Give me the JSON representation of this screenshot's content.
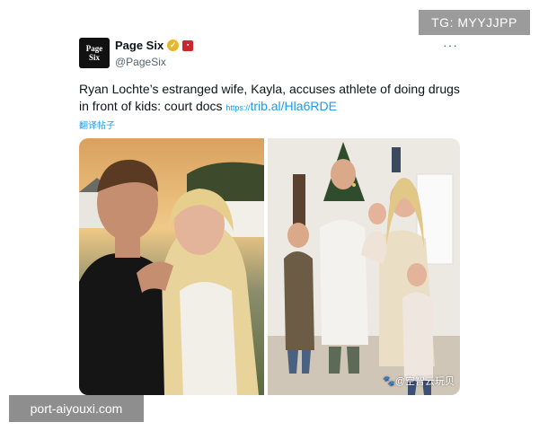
{
  "overlay": {
    "top_right_tag": "TG: MYYJJPP",
    "bottom_left_tag": "port-aiyouxi.com"
  },
  "tweet": {
    "avatar_line1": "Page",
    "avatar_line2": "Six",
    "display_name": "Page Six",
    "handle": "@PageSix",
    "verified_icon": "verified-badge-icon",
    "more_icon": "···",
    "text": "Ryan Lochte’s estranged wife, Kayla, accuses athlete of doing drugs in front of kids: court docs",
    "link_proto": "https://",
    "link_text": "trib.al/Hla6RDE",
    "translate_label": "翻译帖子",
    "media_watermark": "🐾@空智云玩贝"
  },
  "colors": {
    "link": "#1d9bf0",
    "verified": "#e8b82b",
    "affiliate": "#c8282d"
  }
}
